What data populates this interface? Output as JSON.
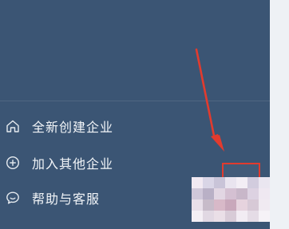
{
  "menu": {
    "items": [
      {
        "label": "全新创建企业",
        "icon": "home-icon"
      },
      {
        "label": "加入其他企业",
        "icon": "plus-circle-icon"
      },
      {
        "label": "帮助与客服",
        "icon": "chat-bubble-icon"
      }
    ]
  },
  "colors": {
    "panel_bg": "#3b5574",
    "menu_text": "#f2f5f8",
    "annotation_red": "#e23b2e"
  }
}
